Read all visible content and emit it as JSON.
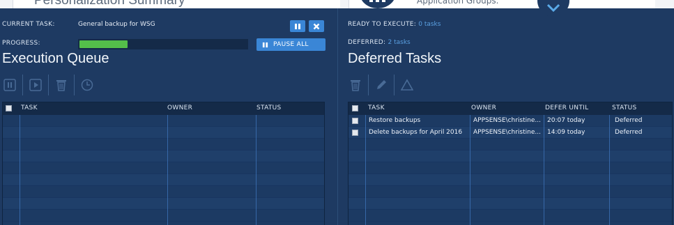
{
  "background": {
    "summary_title": "Personalization Summary",
    "app_groups_text": "Application Groups."
  },
  "left": {
    "current_task_label": "CURRENT TASK:",
    "current_task_value": "General backup for WSG",
    "progress_label": "PROGRESS:",
    "progress_value": 0.3,
    "pause_all_label": "PAUSE ALL",
    "title": "Execution Queue",
    "columns": [
      "TASK",
      "OWNER",
      "STATUS"
    ]
  },
  "right": {
    "ready_label": "READY TO EXECUTE:",
    "ready_value": "0 tasks",
    "deferred_label": "DEFERRED:",
    "deferred_value": "2 tasks",
    "title": "Deferred Tasks",
    "columns": [
      "TASK",
      "OWNER",
      "DEFER UNTIL",
      "STATUS"
    ],
    "rows": [
      {
        "task": "Restore backups",
        "owner": "APPSENSE\\christine...",
        "defer": "20:07 today",
        "status": "Deferred"
      },
      {
        "task": "Delete backups for April 2016",
        "owner": "APPSENSE\\christine...",
        "defer": "14:09 today",
        "status": "Deferred"
      }
    ]
  },
  "icons": [
    "pause-icon",
    "close-icon",
    "play-icon",
    "trash-icon",
    "clock-icon",
    "pencil-icon",
    "warning-icon",
    "chevron-down-icon"
  ],
  "colors": {
    "panel": "#1e3a62",
    "accent": "#3a86d6",
    "progress": "#54bf4a",
    "link": "#5a9fe0"
  }
}
